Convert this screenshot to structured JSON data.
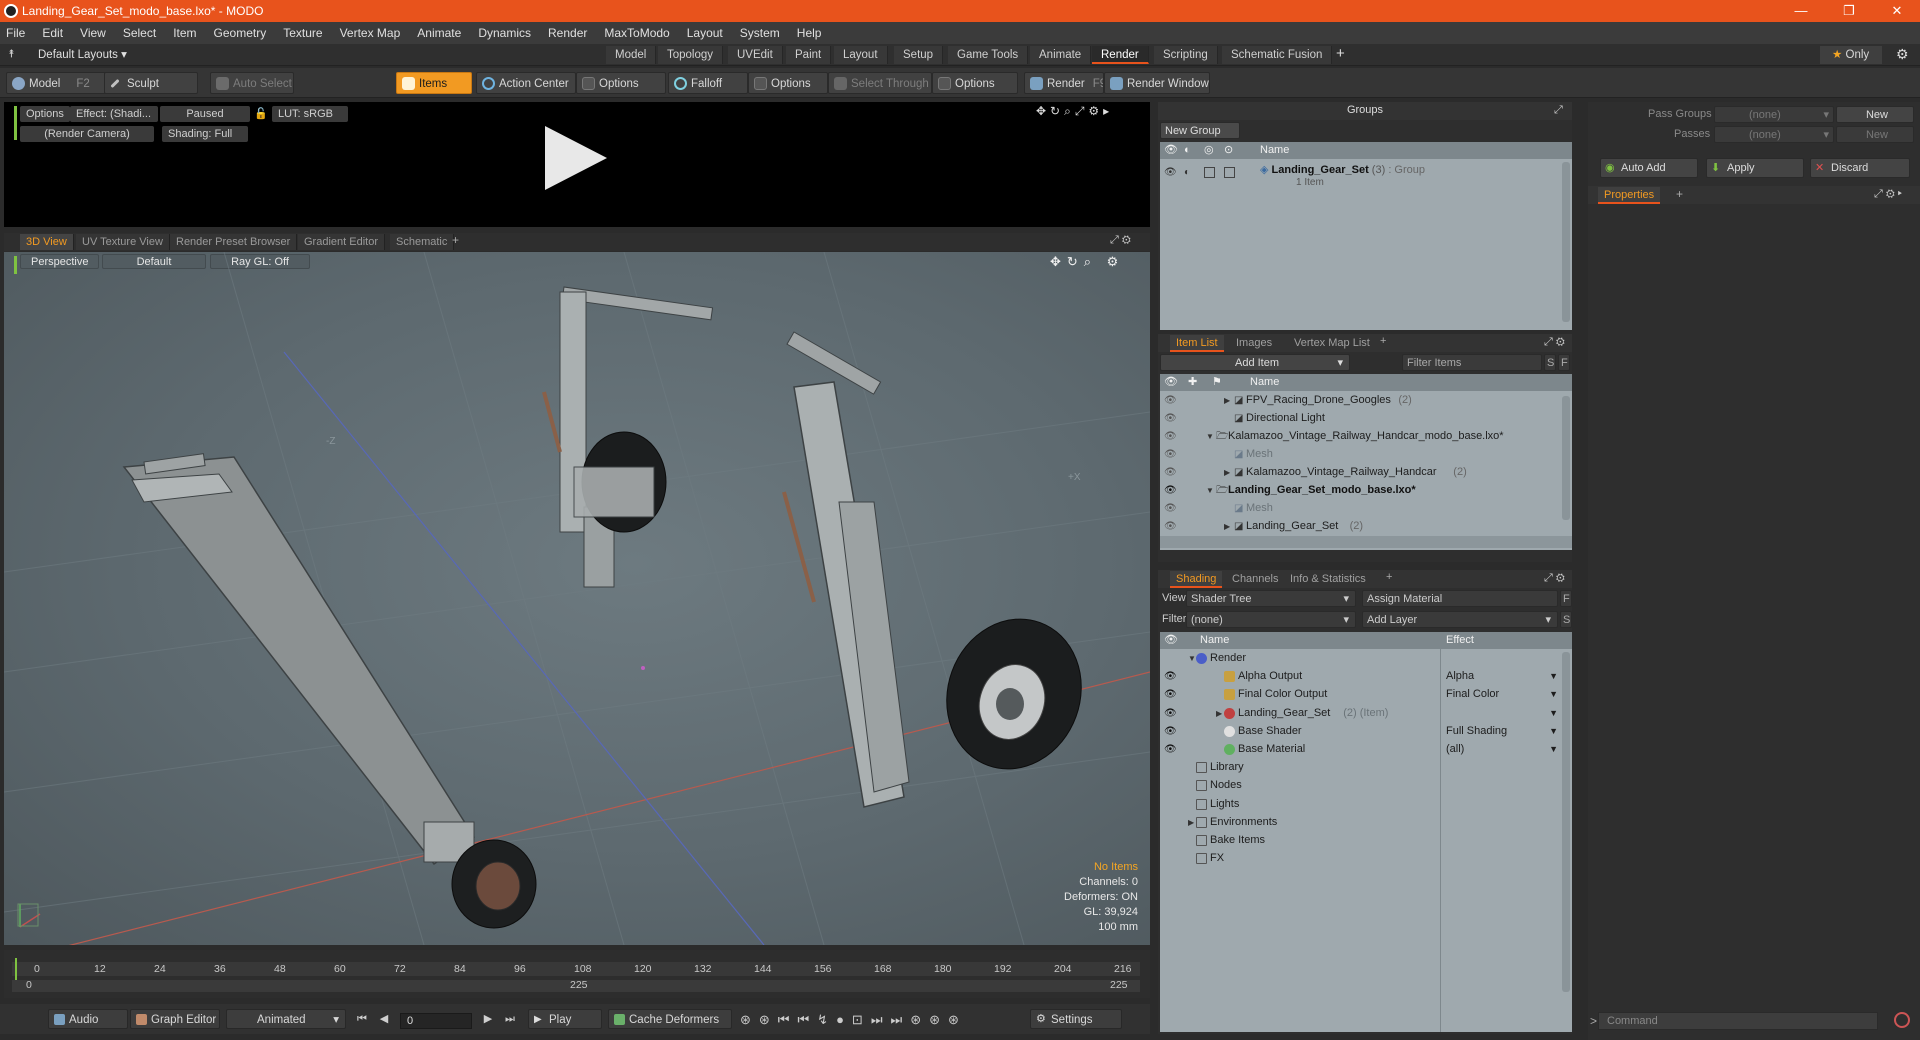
{
  "window": {
    "title": "Landing_Gear_Set_modo_base.lxo* - MODO",
    "minimize": "—",
    "maximize": "❐",
    "close": "✕"
  },
  "menu": [
    "File",
    "Edit",
    "View",
    "Select",
    "Item",
    "Geometry",
    "Texture",
    "Vertex Map",
    "Animate",
    "Dynamics",
    "Render",
    "MaxToModo",
    "Layout",
    "System",
    "Help"
  ],
  "layoutbar": {
    "layout_dropdown": "Default Layouts",
    "tabs": [
      "Model",
      "Topology",
      "UVEdit",
      "Paint",
      "Layout",
      "Setup",
      "Game Tools",
      "Animate",
      "Render",
      "Scripting",
      "Schematic Fusion"
    ],
    "active_tab": "Render",
    "add": "+",
    "only": "Only"
  },
  "toolbar": {
    "model": "Model",
    "model_key": "F2",
    "sculpt": "Sculpt",
    "auto_select": "Auto Select",
    "items": "Items",
    "action_center": "Action Center",
    "options1": "Options",
    "falloff": "Falloff",
    "options2": "Options",
    "select_through": "Select Through",
    "options3": "Options",
    "render": "Render",
    "render_key": "F9",
    "render_window": "Render Window"
  },
  "preview": {
    "options": "Options",
    "effect": "Effect: (Shadi...",
    "paused": "Paused",
    "lut": "LUT: sRGB",
    "camera": "(Render Camera)",
    "shading": "Shading: Full"
  },
  "view_tabs": [
    "3D View",
    "UV Texture View",
    "Render Preset Browser",
    "Gradient Editor",
    "Schematic"
  ],
  "viewport": {
    "perspective": "Perspective",
    "default": "Default",
    "raygl": "Ray GL: Off",
    "axis_z": "-Z",
    "axis_x": "+X",
    "stats": {
      "no_items": "No Items",
      "channels": "Channels: 0",
      "deformers": "Deformers: ON",
      "gl": "GL: 39,924",
      "units": "100 mm"
    }
  },
  "timeline": {
    "ticks": [
      "0",
      "12",
      "24",
      "36",
      "48",
      "60",
      "72",
      "84",
      "96",
      "108",
      "120",
      "132",
      "144",
      "156",
      "168",
      "180",
      "192",
      "204",
      "216"
    ],
    "start": "0",
    "mid": "225",
    "end": "225"
  },
  "bottombar": {
    "audio": "Audio",
    "graph_editor": "Graph Editor",
    "animated": "Animated",
    "frame": "0",
    "play": "Play",
    "cache_deformers": "Cache Deformers",
    "settings": "Settings"
  },
  "groups": {
    "title": "Groups",
    "new_group": "New Group",
    "col_name": "Name",
    "item_name": "Landing_Gear_Set",
    "item_count": "(3)",
    "item_type": ": Group",
    "item_sub": "1 Item"
  },
  "pass_panel": {
    "pass_groups_label": "Pass Groups",
    "pass_groups_value": "(none)",
    "new1": "New",
    "passes_label": "Passes",
    "passes_value": "(none)",
    "new2": "New",
    "auto_add": "Auto Add",
    "apply": "Apply",
    "discard": "Discard",
    "properties_tab": "Properties",
    "command_placeholder": "Command"
  },
  "item_list": {
    "tabs": [
      "Item List",
      "Images",
      "Vertex Map List"
    ],
    "add_item": "Add Item",
    "filter_items": "Filter Items",
    "s": "S",
    "f": "F",
    "col_name": "Name",
    "rows": [
      {
        "indent": 2,
        "arrow": "▶",
        "name": "FPV_Racing_Drone_Googles",
        "count": "(2)",
        "muted": false,
        "bold": false
      },
      {
        "indent": 2,
        "arrow": "",
        "name": "Directional Light",
        "count": "",
        "muted": false,
        "bold": false
      },
      {
        "indent": 1,
        "arrow": "▼",
        "name": "Kalamazoo_Vintage_Railway_Handcar_modo_base.lxo*",
        "count": "",
        "muted": false,
        "bold": false
      },
      {
        "indent": 2,
        "arrow": "",
        "name": "Mesh",
        "count": "",
        "muted": true,
        "bold": false
      },
      {
        "indent": 2,
        "arrow": "▶",
        "name": "Kalamazoo_Vintage_Railway_Handcar",
        "count": "(2)",
        "muted": false,
        "bold": false
      },
      {
        "indent": 1,
        "arrow": "▼",
        "name": "Landing_Gear_Set_modo_base.lxo*",
        "count": "",
        "muted": false,
        "bold": true
      },
      {
        "indent": 2,
        "arrow": "",
        "name": "Mesh",
        "count": "",
        "muted": true,
        "bold": false
      },
      {
        "indent": 2,
        "arrow": "▶",
        "name": "Landing_Gear_Set",
        "count": "(2)",
        "muted": false,
        "bold": false
      }
    ]
  },
  "shading": {
    "tabs": [
      "Shading",
      "Channels",
      "Info & Statistics"
    ],
    "view_label": "View",
    "view_value": "Shader Tree",
    "assign_material": "Assign Material",
    "filter_label": "Filter",
    "filter_value": "(none)",
    "add_layer": "Add Layer",
    "col_name": "Name",
    "col_effect": "Effect",
    "rows": [
      {
        "indent": 0,
        "arrow": "▼",
        "name": "Render",
        "extra": "",
        "effect": ""
      },
      {
        "indent": 1,
        "arrow": "",
        "name": "Alpha Output",
        "extra": "",
        "effect": "Alpha"
      },
      {
        "indent": 1,
        "arrow": "",
        "name": "Final Color Output",
        "extra": "",
        "effect": "Final Color"
      },
      {
        "indent": 1,
        "arrow": "▶",
        "name": "Landing_Gear_Set",
        "extra": "(2) (Item)",
        "effect": ""
      },
      {
        "indent": 1,
        "arrow": "",
        "name": "Base Shader",
        "extra": "",
        "effect": "Full Shading"
      },
      {
        "indent": 1,
        "arrow": "",
        "name": "Base Material",
        "extra": "",
        "effect": "(all)"
      },
      {
        "indent": 0,
        "arrow": "",
        "name": "Library",
        "extra": "",
        "effect": ""
      },
      {
        "indent": 0,
        "arrow": "",
        "name": "Nodes",
        "extra": "",
        "effect": ""
      },
      {
        "indent": 0,
        "arrow": "",
        "name": "Lights",
        "extra": "",
        "effect": ""
      },
      {
        "indent": 0,
        "arrow": "▶",
        "name": "Environments",
        "extra": "",
        "effect": ""
      },
      {
        "indent": 0,
        "arrow": "",
        "name": "Bake Items",
        "extra": "",
        "effect": ""
      },
      {
        "indent": 0,
        "arrow": "",
        "name": "FX",
        "extra": "",
        "effect": ""
      }
    ]
  }
}
